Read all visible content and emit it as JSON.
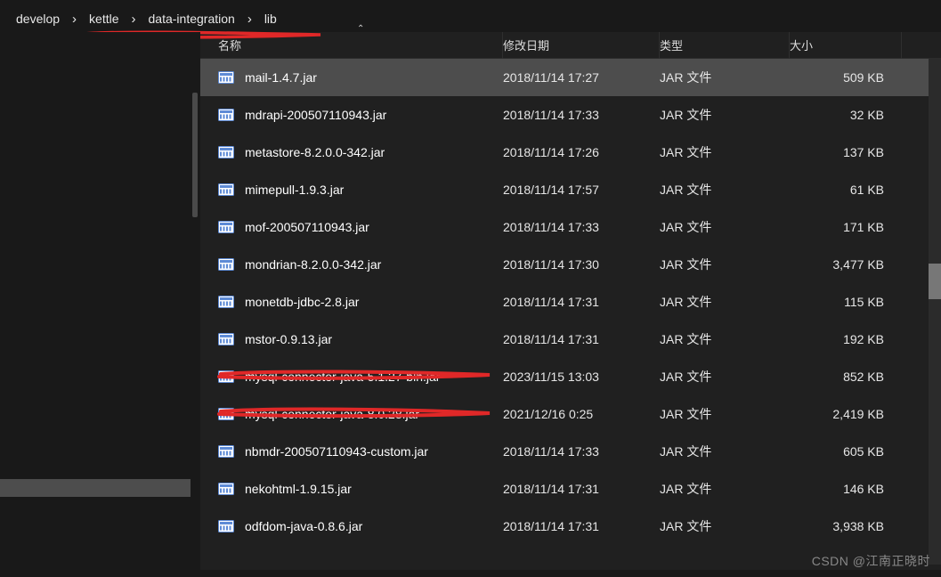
{
  "breadcrumb": {
    "items": [
      {
        "label": "develop"
      },
      {
        "label": "kettle"
      },
      {
        "label": "data-integration"
      },
      {
        "label": "lib"
      }
    ]
  },
  "columns": {
    "name": "名称",
    "date": "修改日期",
    "type": "类型",
    "size": "大小"
  },
  "files": [
    {
      "name": "mail-1.4.7.jar",
      "date": "2018/11/14 17:27",
      "type": "JAR 文件",
      "size": "509 KB",
      "selected": true
    },
    {
      "name": "mdrapi-200507110943.jar",
      "date": "2018/11/14 17:33",
      "type": "JAR 文件",
      "size": "32 KB",
      "selected": false
    },
    {
      "name": "metastore-8.2.0.0-342.jar",
      "date": "2018/11/14 17:26",
      "type": "JAR 文件",
      "size": "137 KB",
      "selected": false
    },
    {
      "name": "mimepull-1.9.3.jar",
      "date": "2018/11/14 17:57",
      "type": "JAR 文件",
      "size": "61 KB",
      "selected": false
    },
    {
      "name": "mof-200507110943.jar",
      "date": "2018/11/14 17:33",
      "type": "JAR 文件",
      "size": "171 KB",
      "selected": false
    },
    {
      "name": "mondrian-8.2.0.0-342.jar",
      "date": "2018/11/14 17:30",
      "type": "JAR 文件",
      "size": "3,477 KB",
      "selected": false
    },
    {
      "name": "monetdb-jdbc-2.8.jar",
      "date": "2018/11/14 17:31",
      "type": "JAR 文件",
      "size": "115 KB",
      "selected": false
    },
    {
      "name": "mstor-0.9.13.jar",
      "date": "2018/11/14 17:31",
      "type": "JAR 文件",
      "size": "192 KB",
      "selected": false
    },
    {
      "name": "mysql-connector-java-5.1.27-bin.jar",
      "date": "2023/11/15 13:03",
      "type": "JAR 文件",
      "size": "852 KB",
      "selected": false
    },
    {
      "name": "mysql-connector-java-8.0.28.jar",
      "date": "2021/12/16 0:25",
      "type": "JAR 文件",
      "size": "2,419 KB",
      "selected": false
    },
    {
      "name": "nbmdr-200507110943-custom.jar",
      "date": "2018/11/14 17:33",
      "type": "JAR 文件",
      "size": "605 KB",
      "selected": false
    },
    {
      "name": "nekohtml-1.9.15.jar",
      "date": "2018/11/14 17:31",
      "type": "JAR 文件",
      "size": "146 KB",
      "selected": false
    },
    {
      "name": "odfdom-java-0.8.6.jar",
      "date": "2018/11/14 17:31",
      "type": "JAR 文件",
      "size": "3,938 KB",
      "selected": false
    }
  ],
  "watermark": "CSDN @江南正晓时",
  "annotation_color": "#e02828"
}
